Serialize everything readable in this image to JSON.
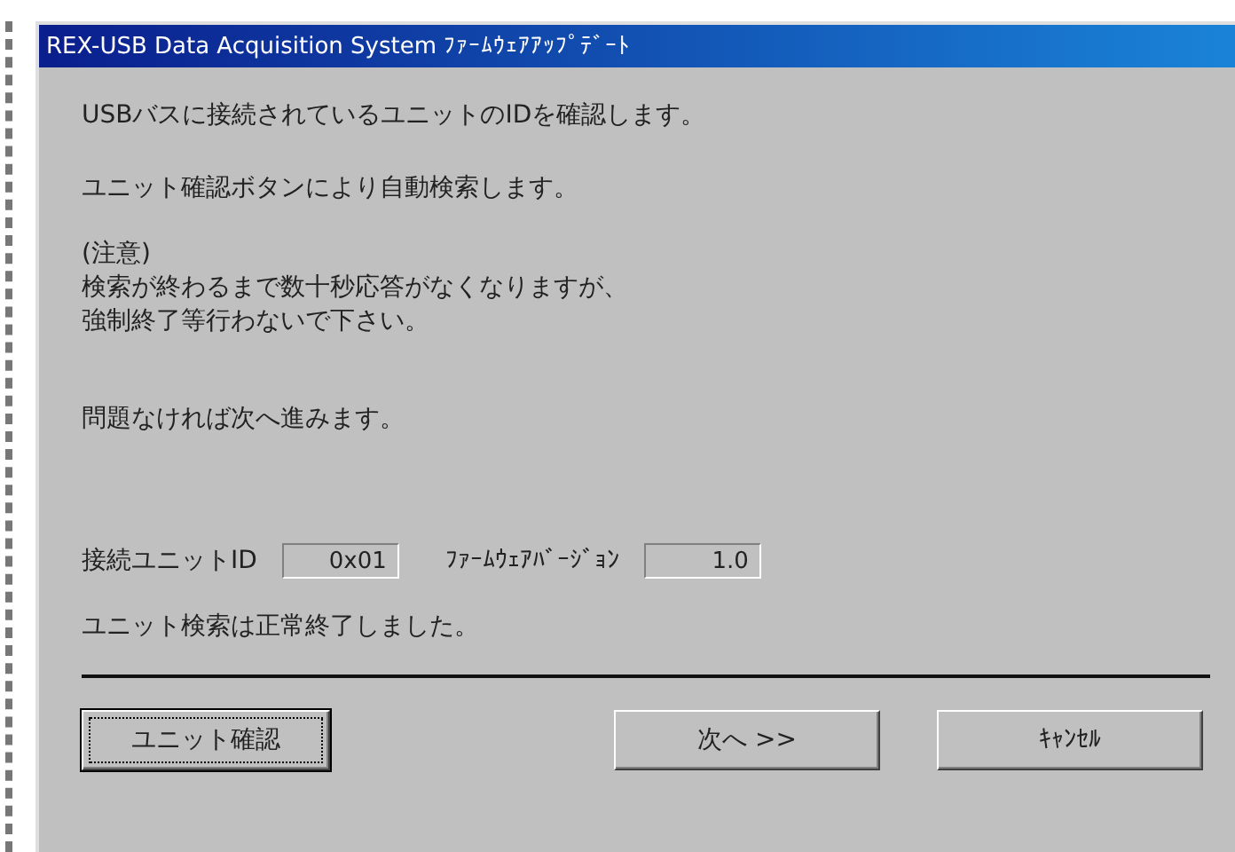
{
  "window": {
    "title": "REX-USB Data Acquisition System ﾌｧｰﾑｳｪｱｱｯﾌﾟﾃﾞｰﾄ"
  },
  "paragraphs": [
    {
      "lines": [
        "USBバスに接続されているユニットのIDを確認します。"
      ]
    },
    {
      "lines": [
        "ユニット確認ボタンにより自動検索します。"
      ]
    },
    {
      "lines": [
        "(注意)",
        "検索が終わるまで数十秒応答がなくなりますが、",
        "強制終了等行わないで下さい。"
      ]
    },
    {
      "lines": [
        "問題なければ次へ進みます。"
      ]
    }
  ],
  "fields": [
    {
      "label": "接続ユニットID",
      "value": "0x01"
    },
    {
      "label": "ﾌｧｰﾑｳｪｱﾊﾞｰｼﾞｮﾝ",
      "value": "1.0"
    }
  ],
  "status": "ユニット検索は正常終了しました。",
  "buttons": [
    {
      "label": "ユニット確認",
      "default": true
    },
    {
      "label": "次へ >>",
      "default": false
    },
    {
      "label": "ｷｬﾝｾﾙ",
      "default": false
    }
  ]
}
